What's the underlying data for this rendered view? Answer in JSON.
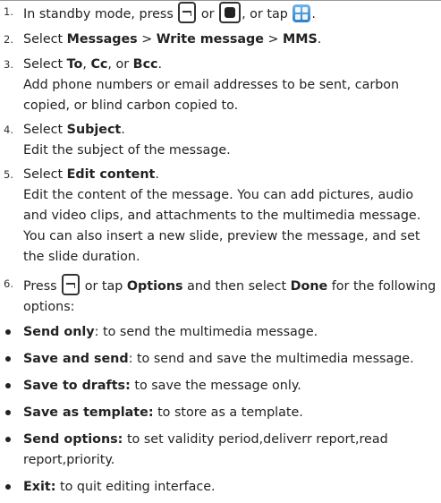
{
  "step1": {
    "num": "1.",
    "p1": "In standby mode, press",
    "p2": "or",
    "p3": ", or tap",
    "p4": "."
  },
  "step2": {
    "num": "2.",
    "p1": "Select ",
    "b1": "Messages",
    "p2": " > ",
    "b2": "Write message",
    "p3": " > ",
    "b3": "MMS",
    "p4": "."
  },
  "step3": {
    "num": "3.",
    "p1": "Select ",
    "b1": "To",
    "p2": ", ",
    "b2": "Cc",
    "p3": ", or ",
    "b3": "Bcc",
    "p4": ".",
    "desc": "Add phone numbers or email addresses to be sent, carbon copied, or blind carbon copied to."
  },
  "step4": {
    "num": "4.",
    "p1": "Select ",
    "b1": "Subject",
    "p2": ".",
    "desc": "Edit the subject of the message."
  },
  "step5": {
    "num": "5.",
    "p1": "Select ",
    "b1": "Edit content",
    "p2": ".",
    "desc": "Edit the content of the message. You can add pictures, audio and video clips, and attachments to the multimedia message. You can also insert a new slide, preview the message, and set the slide duration."
  },
  "step6": {
    "num": "6.",
    "p1": "Press",
    "p2": "or tap ",
    "b1": "Options",
    "p3": " and then select ",
    "b2": "Done",
    "p4": " for the following options:"
  },
  "options": [
    {
      "label": "Send only",
      "text": ": to send the multimedia message."
    },
    {
      "label": "Save and send",
      "text": ": to send and save the multimedia message."
    },
    {
      "label": "Save to drafts:",
      "text": " to save the message only."
    },
    {
      "label": "Save as template:",
      "text": " to store as a template."
    },
    {
      "label": "Send options:",
      "text": " to set validity period,deliverr report,read report,priority."
    },
    {
      "label": "Exit:",
      "text": " to quit editing interface."
    }
  ],
  "icons": {
    "left_softkey": "left-softkey-icon",
    "center_key": "center-key-icon",
    "menu_app": "menu-app-icon"
  },
  "colors": {
    "text": "#222222",
    "icon_blue": "#2e7fc4"
  }
}
